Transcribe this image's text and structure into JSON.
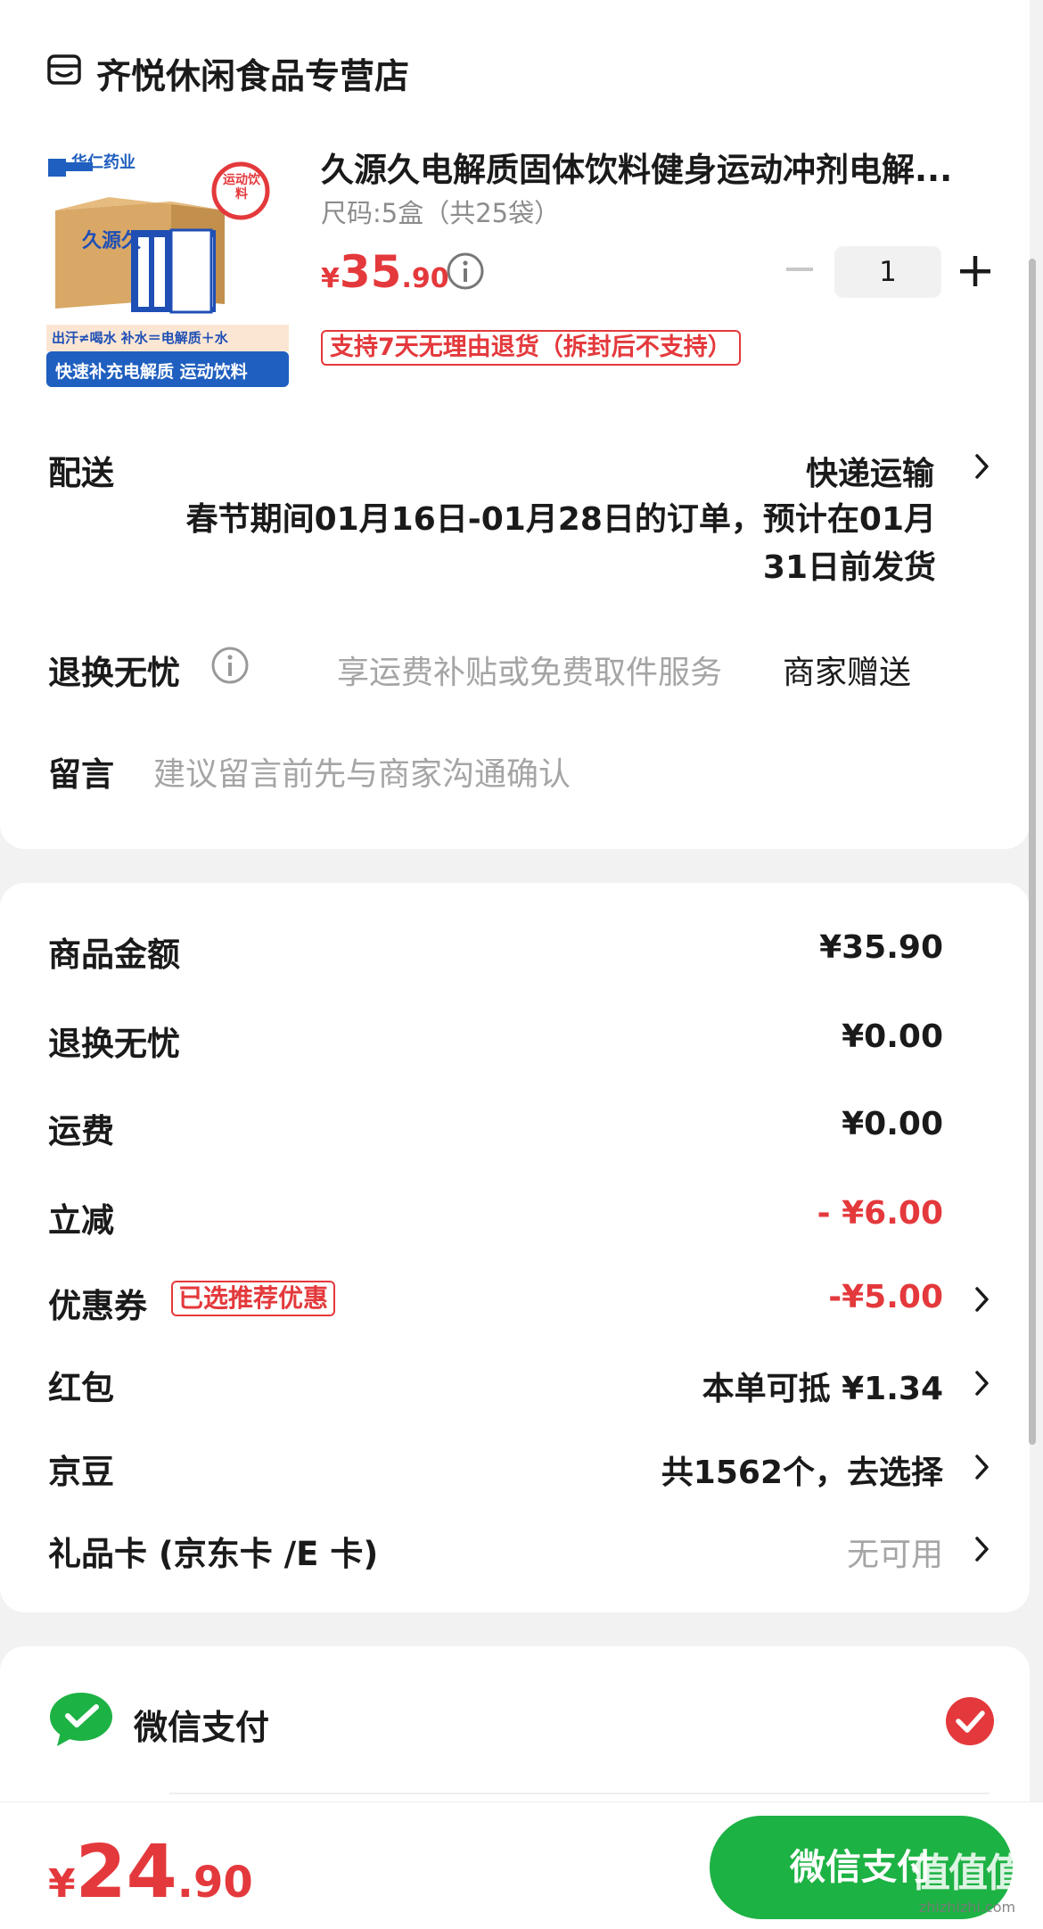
{
  "store": {
    "name": "齐悦休闲食品专营店",
    "icon": "store-icon"
  },
  "product": {
    "title": "久源久电解质固体饮料健身运动冲剂电解...",
    "spec": "尺码:5盒（共25袋）",
    "price": {
      "yen": "¥",
      "int": "35",
      "dec": ".90"
    },
    "quantity": "1",
    "return_tag": "支持7天无理由退货（拆封后不支持）",
    "image": {
      "brand": "华仁药业",
      "badge": "运动饮料",
      "box_text": "久源久",
      "banner_top": "出汗≠喝水 补水＝电解质＋水",
      "banner_bottom": "快速补充电解质 运动饮料"
    }
  },
  "delivery": {
    "label": "配送",
    "method": "快递运输",
    "note": "春节期间01月16日-01月28日的订单，预计在01月31日前发货"
  },
  "worry_free": {
    "label": "退换无忧",
    "desc": "享运费补贴或免费取件服务",
    "value": "商家赠送"
  },
  "message": {
    "label": "留言",
    "placeholder": "建议留言前先与商家沟通确认"
  },
  "summary": {
    "goods": {
      "label": "商品金额",
      "value": "¥35.90"
    },
    "worry": {
      "label": "退换无忧",
      "value": "¥0.00"
    },
    "shipping": {
      "label": "运费",
      "value": "¥0.00"
    },
    "discount": {
      "label": "立减",
      "value": "- ¥6.00"
    },
    "coupon": {
      "label": "优惠券",
      "badge": "已选推荐优惠",
      "value": "-¥5.00"
    },
    "red_packet": {
      "label": "红包",
      "value": "本单可抵 ¥1.34"
    },
    "jd_beans": {
      "label": "京豆",
      "value": "共1562个，去选择"
    },
    "gift_card": {
      "label": "礼品卡 (京东卡 /E 卡)",
      "value": "无可用"
    }
  },
  "payment": {
    "method": "微信支付",
    "icon": "wechat-pay-icon",
    "selected": true
  },
  "bottom": {
    "total": {
      "yen": "¥",
      "int": "24",
      "dec": ".90"
    },
    "pay_button": "微信支付",
    "watermark_big": "值值值",
    "watermark_small": "zhizhizhi.com"
  },
  "colors": {
    "accent_red": "#e4393c",
    "wechat_green": "#1db244",
    "muted_gray": "#a5a5a5",
    "background": "#f2f2f2"
  }
}
